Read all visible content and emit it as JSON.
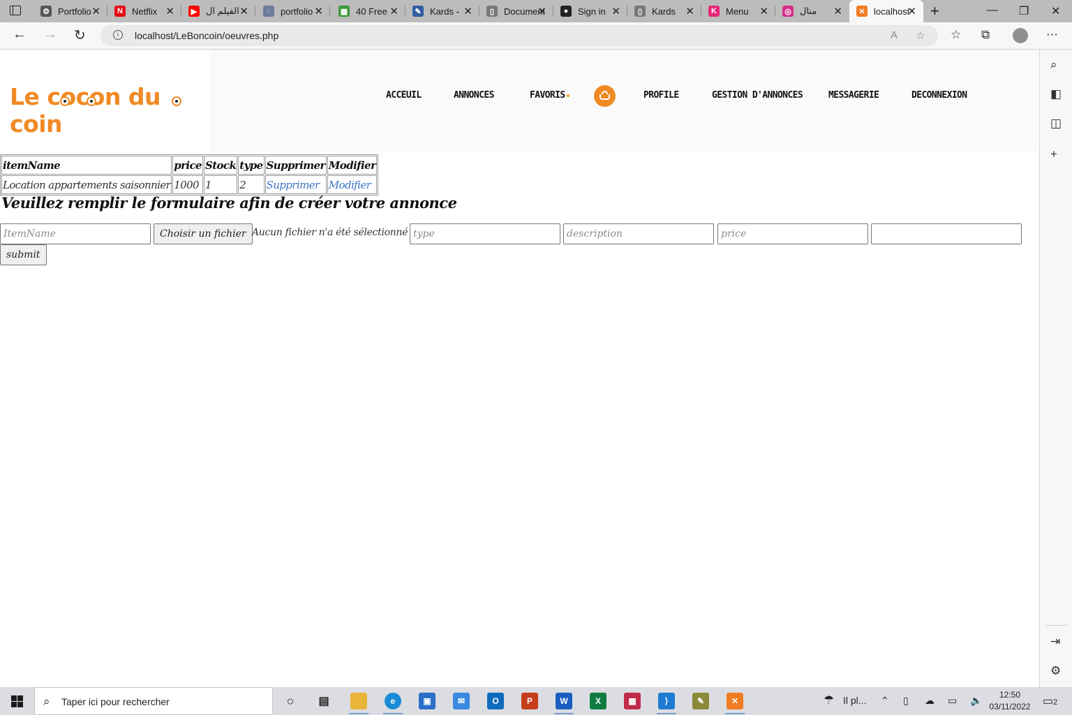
{
  "browser": {
    "tabs": [
      {
        "title": "Portfolio",
        "icon": "settings-icon",
        "color": "#555555",
        "glyph": "⚙"
      },
      {
        "title": "Netflix",
        "icon": "netflix-icon",
        "color": "#e50914",
        "glyph": "N"
      },
      {
        "title": "الفيلم ال",
        "icon": "youtube-icon",
        "color": "#ff0000",
        "glyph": "▶"
      },
      {
        "title": "portfolio",
        "icon": "page-icon",
        "color": "#6a7a9a",
        "glyph": "◌"
      },
      {
        "title": "40 Free",
        "icon": "table-icon",
        "color": "#3a9a3a",
        "glyph": "▦"
      },
      {
        "title": "Kards -",
        "icon": "kards-icon",
        "color": "#2f5fa0",
        "glyph": "✎"
      },
      {
        "title": "Document",
        "icon": "document-icon",
        "color": "#777777",
        "glyph": "▯"
      },
      {
        "title": "Sign in",
        "icon": "github-icon",
        "color": "#222222",
        "glyph": "●"
      },
      {
        "title": "Kards",
        "icon": "document-icon",
        "color": "#777777",
        "glyph": "▯"
      },
      {
        "title": "Menu",
        "icon": "k-icon",
        "color": "#e8287a",
        "glyph": "K"
      },
      {
        "title": "منال",
        "icon": "instagram-icon",
        "color": "#d62f8a",
        "glyph": "◎"
      },
      {
        "title": "localhost",
        "icon": "xampp-icon",
        "color": "#f07c22",
        "glyph": "✕"
      }
    ],
    "url": "localhost/LeBoncoin/oeuvres.php"
  },
  "site": {
    "logo": "Le cocon du coin",
    "menu": [
      "ACCEUIL",
      "ANNONCES",
      "FAVORIS",
      "PROFILE",
      "GESTION D'ANNONCES",
      "MESSAGERIE",
      "DECONNEXION"
    ],
    "accent": "#f08a24"
  },
  "table": {
    "headers": [
      "itemName",
      "price",
      "Stock",
      "type",
      "Supprimer",
      "Modifier"
    ],
    "rows": [
      [
        "Location appartements saisonnier",
        "1000",
        "1",
        "2",
        "Supprimer",
        "Modifier"
      ]
    ]
  },
  "form": {
    "title": "Veuillez remplir le formulaire afin de créer votre annonce",
    "item_placeholder": "ItemName",
    "file_button": "Choisir un fichier",
    "no_file": "Aucun fichier n'a été sélectionné",
    "type_placeholder": "type",
    "description_placeholder": "description",
    "price_placeholder": "price",
    "submit": "submit"
  },
  "taskbar": {
    "search_placeholder": "Taper ici pour rechercher",
    "weather": "Il pl...",
    "time": "12:50",
    "date": "03/11/2022",
    "notifications": "2"
  }
}
